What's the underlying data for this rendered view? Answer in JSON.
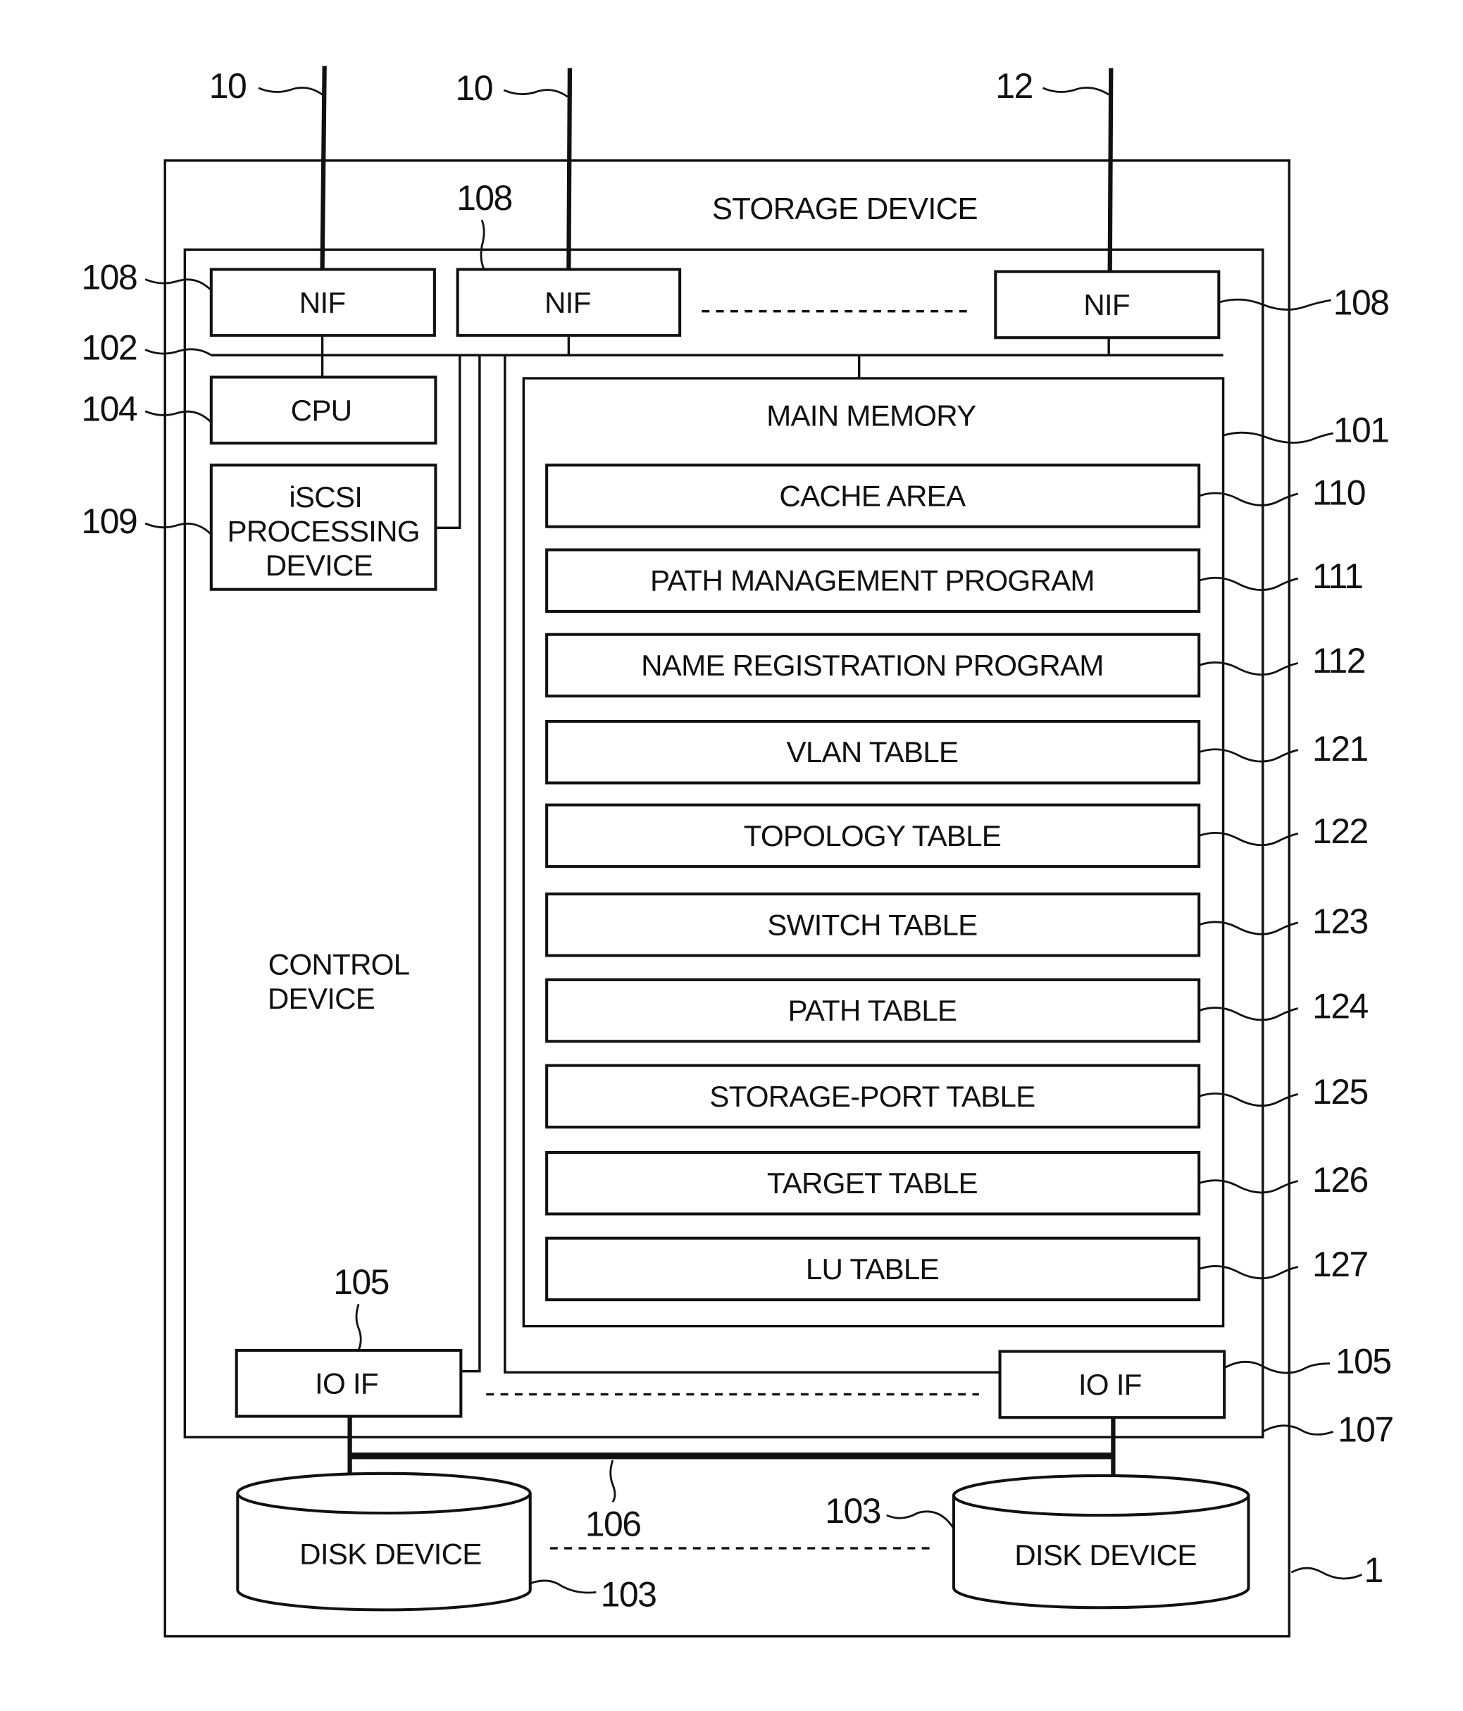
{
  "figure": {
    "title": "STORAGE DEVICE",
    "storage_ref": "1",
    "control_device_label_line1": "CONTROL",
    "control_device_label_line2": "DEVICE",
    "control_device_ref": "107"
  },
  "networks": [
    {
      "ref": "10"
    },
    {
      "ref": "10"
    },
    {
      "ref": "12"
    }
  ],
  "nifs": [
    {
      "label": "NIF",
      "ref": "108"
    },
    {
      "label": "NIF",
      "ref": "108"
    },
    {
      "label": "NIF",
      "ref": "108"
    }
  ],
  "internal_bus": {
    "ref": "102"
  },
  "cpu": {
    "label": "CPU",
    "ref": "104"
  },
  "iscsi": {
    "line1": "iSCSI",
    "line2": "PROCESSING",
    "line3": "DEVICE",
    "ref": "109"
  },
  "main_memory": {
    "label": "MAIN MEMORY",
    "ref": "101",
    "items": [
      {
        "label": "CACHE AREA",
        "ref": "110"
      },
      {
        "label": "PATH MANAGEMENT PROGRAM",
        "ref": "111"
      },
      {
        "label": "NAME REGISTRATION PROGRAM",
        "ref": "112"
      },
      {
        "label": "VLAN TABLE",
        "ref": "121"
      },
      {
        "label": "TOPOLOGY TABLE",
        "ref": "122"
      },
      {
        "label": "SWITCH TABLE",
        "ref": "123"
      },
      {
        "label": "PATH TABLE",
        "ref": "124"
      },
      {
        "label": "STORAGE-PORT TABLE",
        "ref": "125"
      },
      {
        "label": "TARGET TABLE",
        "ref": "126"
      },
      {
        "label": "LU TABLE",
        "ref": "127"
      }
    ]
  },
  "io_ifs": [
    {
      "label": "IO IF",
      "ref": "105"
    },
    {
      "label": "IO IF",
      "ref": "105"
    }
  ],
  "disk_bus": {
    "ref": "106"
  },
  "disks": [
    {
      "label": "DISK DEVICE",
      "ref": "103"
    },
    {
      "label": "DISK DEVICE",
      "ref": "103"
    }
  ]
}
